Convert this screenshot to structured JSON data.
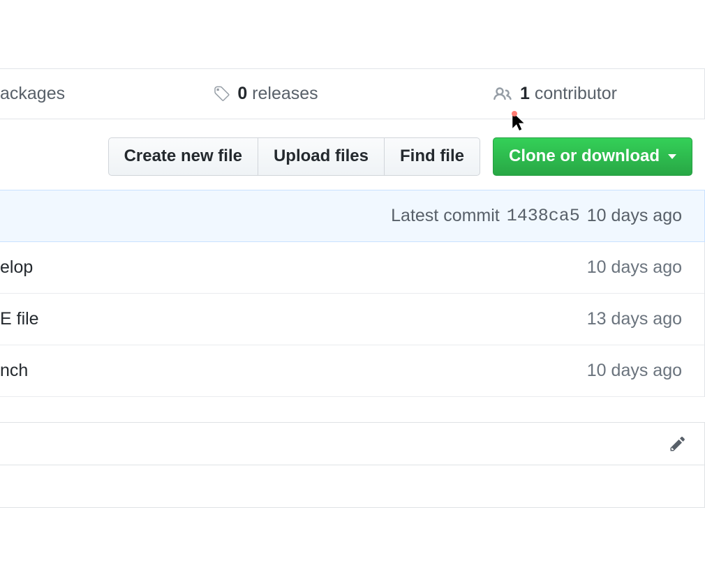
{
  "stats": {
    "packages_label": "ackages",
    "releases_count": "0",
    "releases_label": "releases",
    "contributor_count": "1",
    "contributor_label": "contributor"
  },
  "actions": {
    "create_new_file": "Create new file",
    "upload_files": "Upload files",
    "find_file": "Find file",
    "clone_or_download": "Clone or download"
  },
  "commit": {
    "latest_label": "Latest commit",
    "sha": "1438ca5",
    "time": "10 days ago"
  },
  "files": [
    {
      "fragment": "elop",
      "time": "10 days ago"
    },
    {
      "fragment": "E file",
      "time": "13 days ago"
    },
    {
      "fragment": "nch",
      "time": "10 days ago"
    }
  ]
}
